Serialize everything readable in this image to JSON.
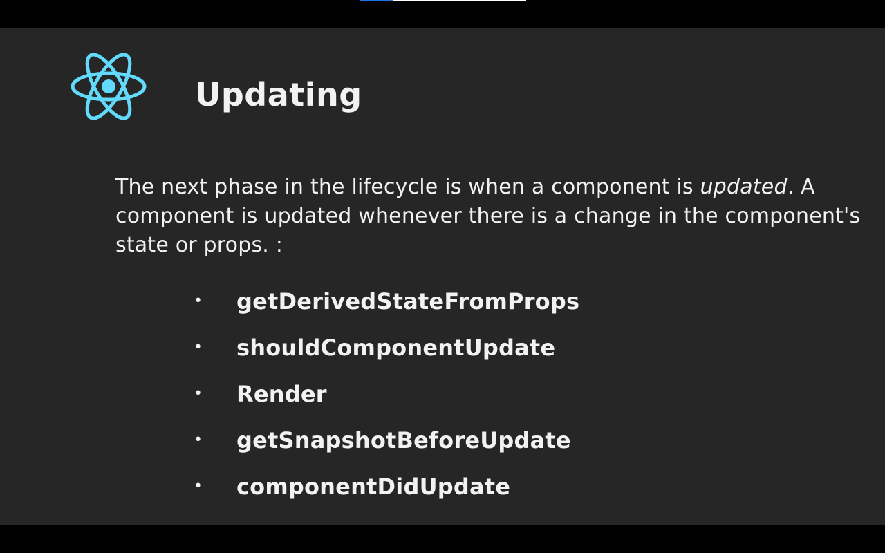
{
  "playback": {
    "progress_fraction": 0.2,
    "accent_color": "#1a73e8"
  },
  "slide": {
    "logo_icon": "react-atom-icon",
    "logo_color": "#61dafb",
    "title": "Updating",
    "intro": {
      "before": "The next phase in the lifecycle is when a component is ",
      "emphasis": "updated",
      "after": ". A component is updated whenever there is a change in the component's state or props. :"
    },
    "methods": [
      "getDerivedStateFromProps",
      "shouldComponentUpdate",
      "Render",
      "getSnapshotBeforeUpdate",
      "componentDidUpdate"
    ],
    "bullet_symbol": "•"
  }
}
